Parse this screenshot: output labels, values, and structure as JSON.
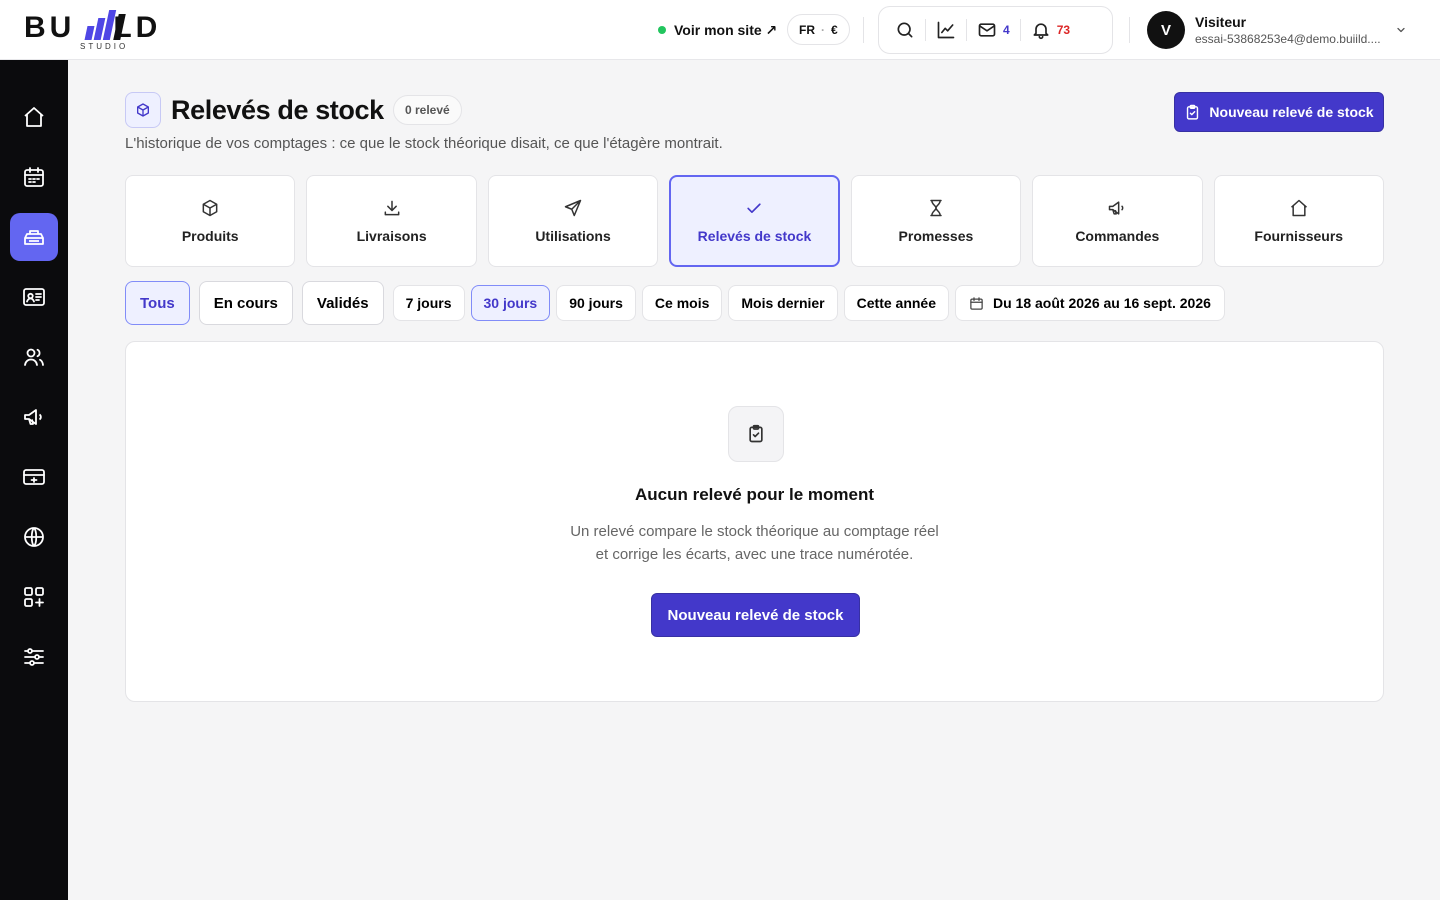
{
  "brand": {
    "name_left": "BU",
    "name_right": "LD",
    "sub": "STUDIO",
    "accent": "#4f46e5"
  },
  "topbar": {
    "visit_site": "Voir mon site ↗",
    "language": "FR",
    "currency": "€",
    "messages_count": "4",
    "notifications_count": "73",
    "user_initial": "V",
    "user_name": "Visiteur",
    "user_email": "essai-53868253e4@demo.buiild...."
  },
  "sidebar": {
    "items": [
      "home-icon",
      "calendar-icon",
      "inventory-icon",
      "contact-card-icon",
      "users-icon",
      "megaphone-icon",
      "payment-icon",
      "globe-icon",
      "apps-add-icon",
      "settings-sliders-icon"
    ],
    "active_index": 2
  },
  "header": {
    "title": "Relevés de stock",
    "badge": "0 relevé",
    "subtitle": "L'historique de vos comptages : ce que le stock théorique disait, ce que l'étagère montrait.",
    "new_button": "Nouveau relevé de stock"
  },
  "tiles": [
    {
      "label": "Produits",
      "icon": "box-icon"
    },
    {
      "label": "Livraisons",
      "icon": "download-icon"
    },
    {
      "label": "Utilisations",
      "icon": "send-icon"
    },
    {
      "label": "Relevés de stock",
      "icon": "check-icon",
      "active": true
    },
    {
      "label": "Promesses",
      "icon": "hourglass-icon"
    },
    {
      "label": "Commandes",
      "icon": "megaphone-icon"
    },
    {
      "label": "Fournisseurs",
      "icon": "house-icon"
    }
  ],
  "filters": {
    "status": [
      "Tous",
      "En cours",
      "Validés"
    ],
    "status_active": "Tous",
    "periods": [
      "7 jours",
      "30 jours",
      "90 jours",
      "Ce mois",
      "Mois dernier",
      "Cette année"
    ],
    "period_active": "30 jours",
    "date_range": "Du 18 août 2026 au 16 sept. 2026"
  },
  "empty_state": {
    "title": "Aucun relevé pour le moment",
    "line1": "Un relevé compare le stock théorique au comptage réel",
    "line2": "et corrige les écarts, avec une trace numérotée.",
    "button": "Nouveau relevé de stock"
  }
}
